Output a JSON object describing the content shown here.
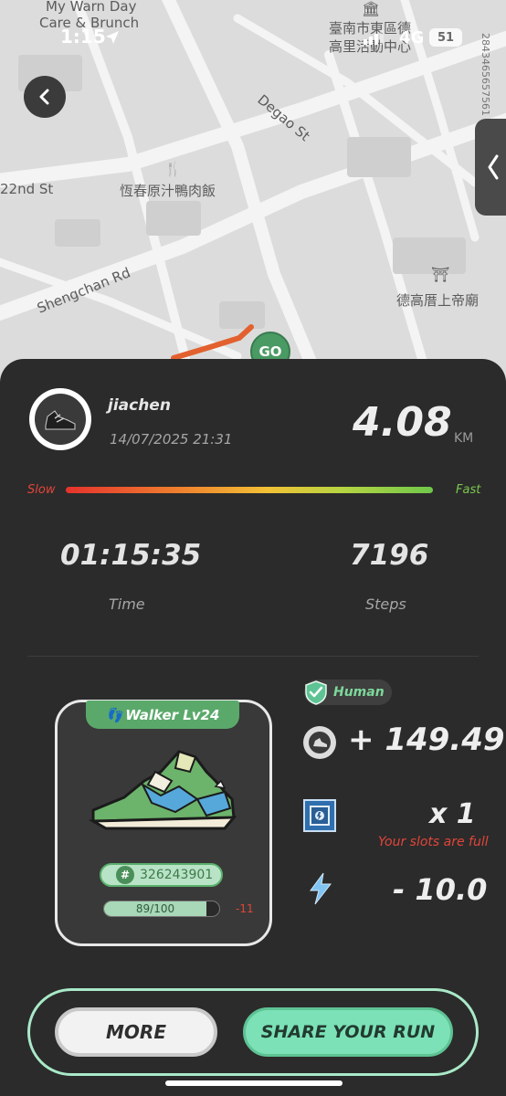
{
  "status_bar": {
    "time": "1:15",
    "network": "4G",
    "battery": "51"
  },
  "map": {
    "poi_top_left_line1": "My Warn Day",
    "poi_top_left_line2": "Care & Brunch",
    "poi_top_right_line1": "臺南市東區德",
    "poi_top_right_line2": "高里活動中心",
    "street_degao": "Degao St",
    "street_22nd": "22nd St",
    "restaurant": "恆春原汁鴨肉飯",
    "street_shengchan": "Shengchan Rd",
    "temple": "德高厝上帝廟",
    "vertical_code": "2843465657561",
    "go_label": "GO"
  },
  "run": {
    "username": "jiachen",
    "datetime": "14/07/2025 21:31",
    "distance": "4.08",
    "distance_unit": "KM",
    "speed_slow_label": "Slow",
    "speed_fast_label": "Fast",
    "time_value": "01:15:35",
    "time_label": "Time",
    "steps_value": "7196",
    "steps_label": "Steps"
  },
  "sneaker": {
    "level_label": "Walker Lv24",
    "id": "326243901",
    "durability_text": "89/100",
    "durability_fraction": 0.89,
    "durability_delta": "-11"
  },
  "rewards": {
    "human_label": "Human",
    "gst_value": "+ 149.49",
    "mystery_box_value": "x 1",
    "slots_full_text": "Your slots are full",
    "energy_value": "- 10.0"
  },
  "actions": {
    "more_label": "MORE",
    "share_label": "SHARE YOUR RUN"
  },
  "colors": {
    "accent_green": "#7ce1b7",
    "danger_red": "#e2453a",
    "sheet_bg": "#2b2b2b"
  }
}
